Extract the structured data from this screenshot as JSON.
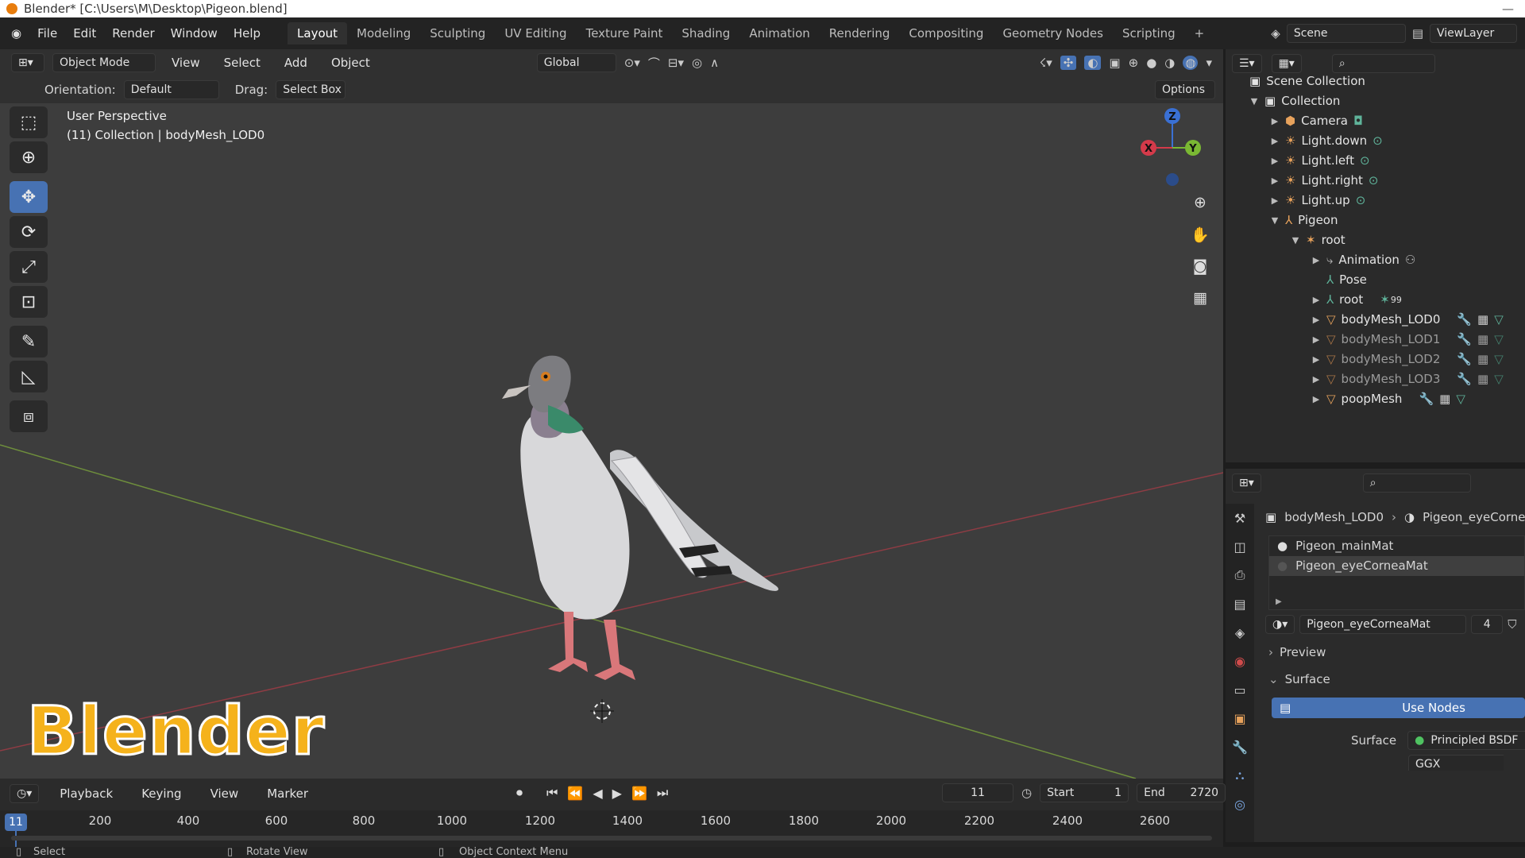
{
  "title_bar": {
    "text": "Blender* [C:\\Users\\M\\Desktop\\Pigeon.blend]",
    "window_controls": "—"
  },
  "menu": {
    "items": [
      "File",
      "Edit",
      "Render",
      "Window",
      "Help"
    ],
    "workspaces": [
      "Layout",
      "Modeling",
      "Sculpting",
      "UV Editing",
      "Texture Paint",
      "Shading",
      "Animation",
      "Rendering",
      "Compositing",
      "Geometry Nodes",
      "Scripting"
    ],
    "add_tab": "+",
    "scene": "Scene",
    "view_layer": "ViewLayer"
  },
  "header": {
    "mode": "Object Mode",
    "menus": [
      "View",
      "Select",
      "Add",
      "Object"
    ],
    "transform_orientation": "Global",
    "orientation_label": "Orientation:",
    "orientation_value": "Default",
    "drag_label": "Drag:",
    "drag_value": "Select Box",
    "options": "Options"
  },
  "viewport": {
    "perspective": "User Perspective",
    "context": "(11) Collection | bodyMesh_LOD0",
    "logo_text": "Blender",
    "gizmo": {
      "x": "X",
      "y": "Y",
      "z": "Z"
    }
  },
  "toolbar": {
    "tools": [
      "select-box-icon",
      "cursor-icon",
      "move-icon",
      "rotate-icon",
      "scale-icon",
      "transform-icon",
      "annotate-icon",
      "measure-icon",
      "add-cube-icon"
    ],
    "active": "move-icon"
  },
  "outliner": {
    "scene_collection": "Scene Collection",
    "collection": "Collection",
    "items": [
      {
        "label": "Camera"
      },
      {
        "label": "Light.down"
      },
      {
        "label": "Light.left"
      },
      {
        "label": "Light.right"
      },
      {
        "label": "Light.up"
      },
      {
        "label": "Pigeon"
      },
      {
        "label": "root"
      },
      {
        "label": "Animation"
      },
      {
        "label": "Pose"
      },
      {
        "label": "root",
        "badge": "99"
      },
      {
        "label": "bodyMesh_LOD0"
      },
      {
        "label": "bodyMesh_LOD1"
      },
      {
        "label": "bodyMesh_LOD2"
      },
      {
        "label": "bodyMesh_LOD3"
      },
      {
        "label": "poopMesh"
      }
    ]
  },
  "properties": {
    "breadcrumb_object": "bodyMesh_LOD0",
    "breadcrumb_material": "Pigeon_eyeCorneaMat",
    "slots": [
      "Pigeon_mainMat",
      "Pigeon_eyeCorneaMat"
    ],
    "material_name": "Pigeon_eyeCorneaMat",
    "users": "4",
    "preview": "Preview",
    "surface_section": "Surface",
    "use_nodes": "Use Nodes",
    "surface_label": "Surface",
    "surface_value": "Principled BSDF",
    "next_value": "GGX"
  },
  "timeline": {
    "menus": [
      "Playback",
      "Keying",
      "View",
      "Marker"
    ],
    "current_frame": "11",
    "start_label": "Start",
    "start": "1",
    "end_label": "End",
    "end": "2720",
    "ticks": [
      "11",
      "200",
      "400",
      "600",
      "800",
      "1000",
      "1200",
      "1400",
      "1600",
      "1800",
      "2000",
      "2200",
      "2400",
      "2600"
    ]
  },
  "status": {
    "select": "Select",
    "rotate": "Rotate View",
    "context": "Object Context Menu"
  }
}
